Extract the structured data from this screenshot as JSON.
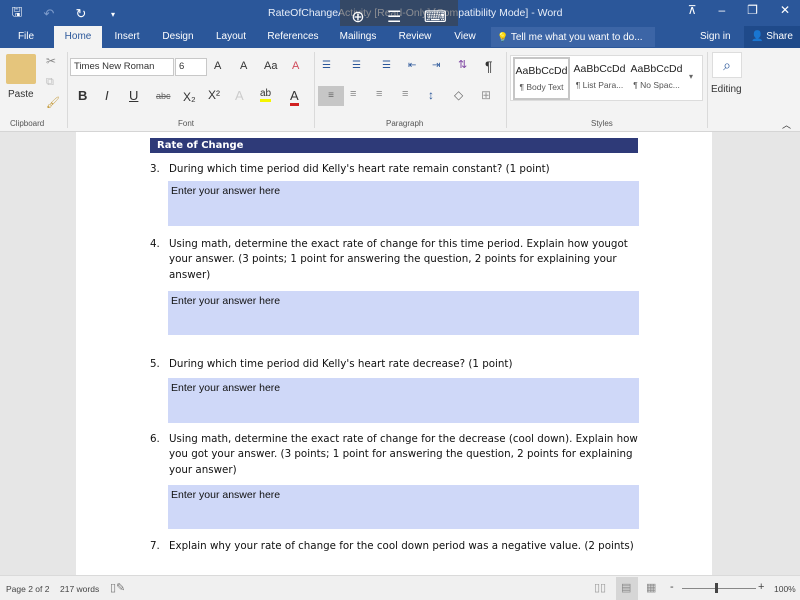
{
  "titlebar": {
    "title": "RateOfChangeActivity [Read-Only] [Compatibility Mode] - Word",
    "qat": [
      {
        "name": "save-icon",
        "glyph": "🖫"
      },
      {
        "name": "undo-icon",
        "glyph": "↶"
      },
      {
        "name": "redo-icon",
        "glyph": "↻"
      },
      {
        "name": "customize-qat-icon",
        "glyph": "▾"
      }
    ],
    "window_controls": {
      "ribbon_display": "⊼",
      "minimize": "–",
      "restore": "❐",
      "close": "✕"
    },
    "touch_overlay": {
      "zoom": "⊕",
      "menu": "☰",
      "keyboard": "⌨"
    }
  },
  "tabs": [
    "File",
    "Home",
    "Insert",
    "Design",
    "Layout",
    "References",
    "Mailings",
    "Review",
    "View"
  ],
  "active_tab": "Home",
  "tell_me": {
    "icon": "💡",
    "placeholder": "Tell me what you want to do..."
  },
  "sign_in": "Sign in",
  "share": "Share",
  "ribbon": {
    "clipboard": {
      "label": "Clipboard",
      "paste": "Paste"
    },
    "font": {
      "label": "Font",
      "font_name": "Times New Roman",
      "font_size": "6",
      "buttons": {
        "grow": "A",
        "shrink": "A",
        "case": "Aa",
        "clear": "A",
        "bold": "B",
        "italic": "I",
        "underline": "U",
        "strike": "abc",
        "subscript": "X₂",
        "superscript": "X²",
        "effects": "A",
        "highlight": "ab",
        "color": "A"
      }
    },
    "paragraph": {
      "label": "Paragraph",
      "pilcrow": "¶"
    },
    "styles": {
      "label": "Styles",
      "items": [
        {
          "sample": "AaBbCcDd",
          "name": "¶ Body Text"
        },
        {
          "sample": "AaBbCcDd",
          "name": "¶ List Para..."
        },
        {
          "sample": "AaBbCcDd",
          "name": "¶ No Spac..."
        }
      ]
    },
    "editing": {
      "label": "Editing"
    }
  },
  "document": {
    "section_title": "Rate of Change",
    "answer_placeholder": "Enter your answer here",
    "questions": [
      {
        "num": "3.",
        "text": "During which time period did Kelly's heart rate remain constant? (1 point)"
      },
      {
        "num": "4.",
        "text": "Using math, determine the exact rate of change for this time period. Explain how yougot your answer. (3 points; 1 point for answering the question, 2 points for explaining your answer)"
      },
      {
        "num": "5.",
        "text": "During which time period did Kelly's heart rate decrease? (1 point)"
      },
      {
        "num": "6.",
        "text": "Using math, determine the exact rate of change for the decrease (cool down). Explain how you got your answer. (3 points; 1 point for answering the question, 2 points for explaining your answer)"
      },
      {
        "num": "7.",
        "text": "Explain why your rate of change for the cool down period was a negative value. (2 points)"
      }
    ]
  },
  "status": {
    "page": "Page 2 of 2",
    "words": "217 words",
    "zoom_minus": "-",
    "zoom_plus": "+",
    "zoom_level": "100%",
    "zoom_percent": 100
  }
}
